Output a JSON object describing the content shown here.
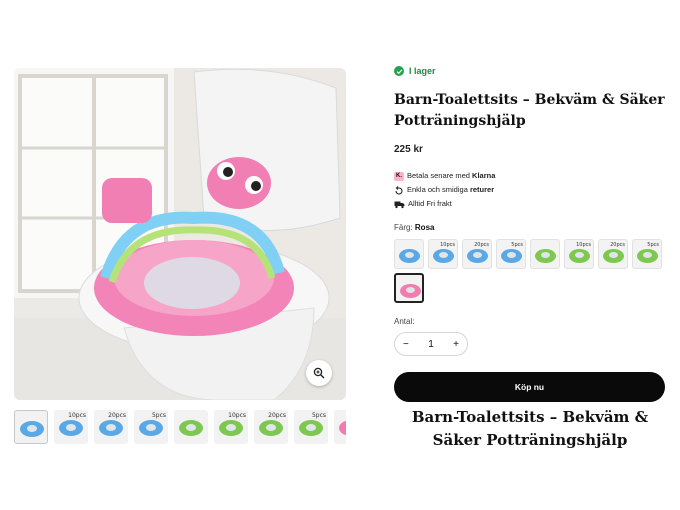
{
  "product": {
    "stock_status": "I lager",
    "title": "Barn-Toalettsits – Bekväm & Säker Potträningshjälp",
    "price": "225 kr",
    "perks": [
      {
        "icon": "klarna-icon",
        "prefix": "Betala senare med ",
        "strong": "Klarna",
        "suffix": ""
      },
      {
        "icon": "returns-icon",
        "prefix": "Enkla och smidiga ",
        "strong": "returer",
        "suffix": ""
      },
      {
        "icon": "truck-icon",
        "prefix": "Alltid Fri frakt",
        "strong": "",
        "suffix": ""
      }
    ],
    "klarna_badge": "K.",
    "color_label": "Färg:",
    "color_value": "Rosa",
    "quantity_label": "Antal:",
    "quantity": "1",
    "qty_minus": "−",
    "qty_plus": "+",
    "buy_label": "Köp nu",
    "heading_bottom": "Barn-Toalettsits – Bekväm & Säker Potträningshjälp"
  },
  "colors": {
    "accent": "#0a0a0a",
    "stock": "#22a24f",
    "blue_seat": "#5aa9e6",
    "green_seat": "#7ec850",
    "pink_seat": "#f07cb0"
  },
  "swatches": [
    {
      "tag": "",
      "color": "blue"
    },
    {
      "tag": "10pcs",
      "color": "blue"
    },
    {
      "tag": "20pcs",
      "color": "blue"
    },
    {
      "tag": "5pcs",
      "color": "blue"
    },
    {
      "tag": "",
      "color": "green"
    },
    {
      "tag": "10pcs",
      "color": "green"
    },
    {
      "tag": "20pcs",
      "color": "green"
    },
    {
      "tag": "5pcs",
      "color": "green"
    },
    {
      "tag": "",
      "color": "pink",
      "selected": true
    }
  ],
  "thumbnails": [
    {
      "tag": "",
      "color": "blue"
    },
    {
      "tag": "10pcs",
      "color": "blue"
    },
    {
      "tag": "20pcs",
      "color": "blue"
    },
    {
      "tag": "5pcs",
      "color": "blue"
    },
    {
      "tag": "",
      "color": "green"
    },
    {
      "tag": "10pcs",
      "color": "green"
    },
    {
      "tag": "20pcs",
      "color": "green"
    },
    {
      "tag": "5pcs",
      "color": "green"
    },
    {
      "tag": "",
      "color": "pink"
    }
  ]
}
